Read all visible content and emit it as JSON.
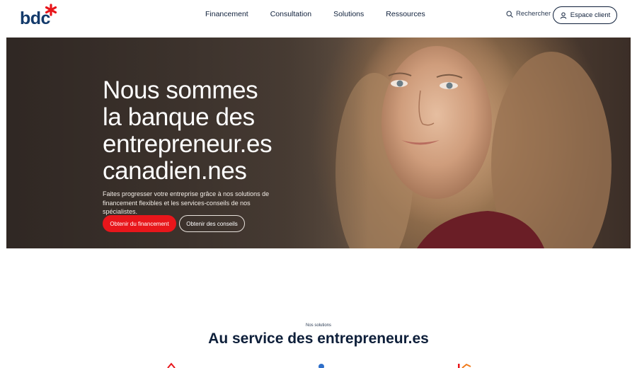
{
  "brand": {
    "name": "bdc",
    "star_color": "#e8161b",
    "text_color": "#133a6b"
  },
  "nav": {
    "items": [
      "Financement",
      "Consultation",
      "Solutions",
      "Ressources"
    ],
    "search_label": "Rechercher",
    "client_label": "Espace client"
  },
  "hero": {
    "title_lines": [
      "Nous sommes",
      "la banque des",
      "entrepreneur.es",
      "canadien.nes"
    ],
    "subtitle": "Faites progresser votre entreprise grâce à nos solutions de financement flexibles et les services-conseils de nos spécialistes.",
    "primary_cta": "Obtenir du financement",
    "secondary_cta": "Obtenir des conseils",
    "accent": "#e8161b"
  },
  "solutions": {
    "eyebrow": "Nos solutions",
    "title": "Au service des entrepreneur.es",
    "icons": [
      "red-house-icon",
      "blue-drop-icon",
      "orange-chart-icon"
    ]
  }
}
